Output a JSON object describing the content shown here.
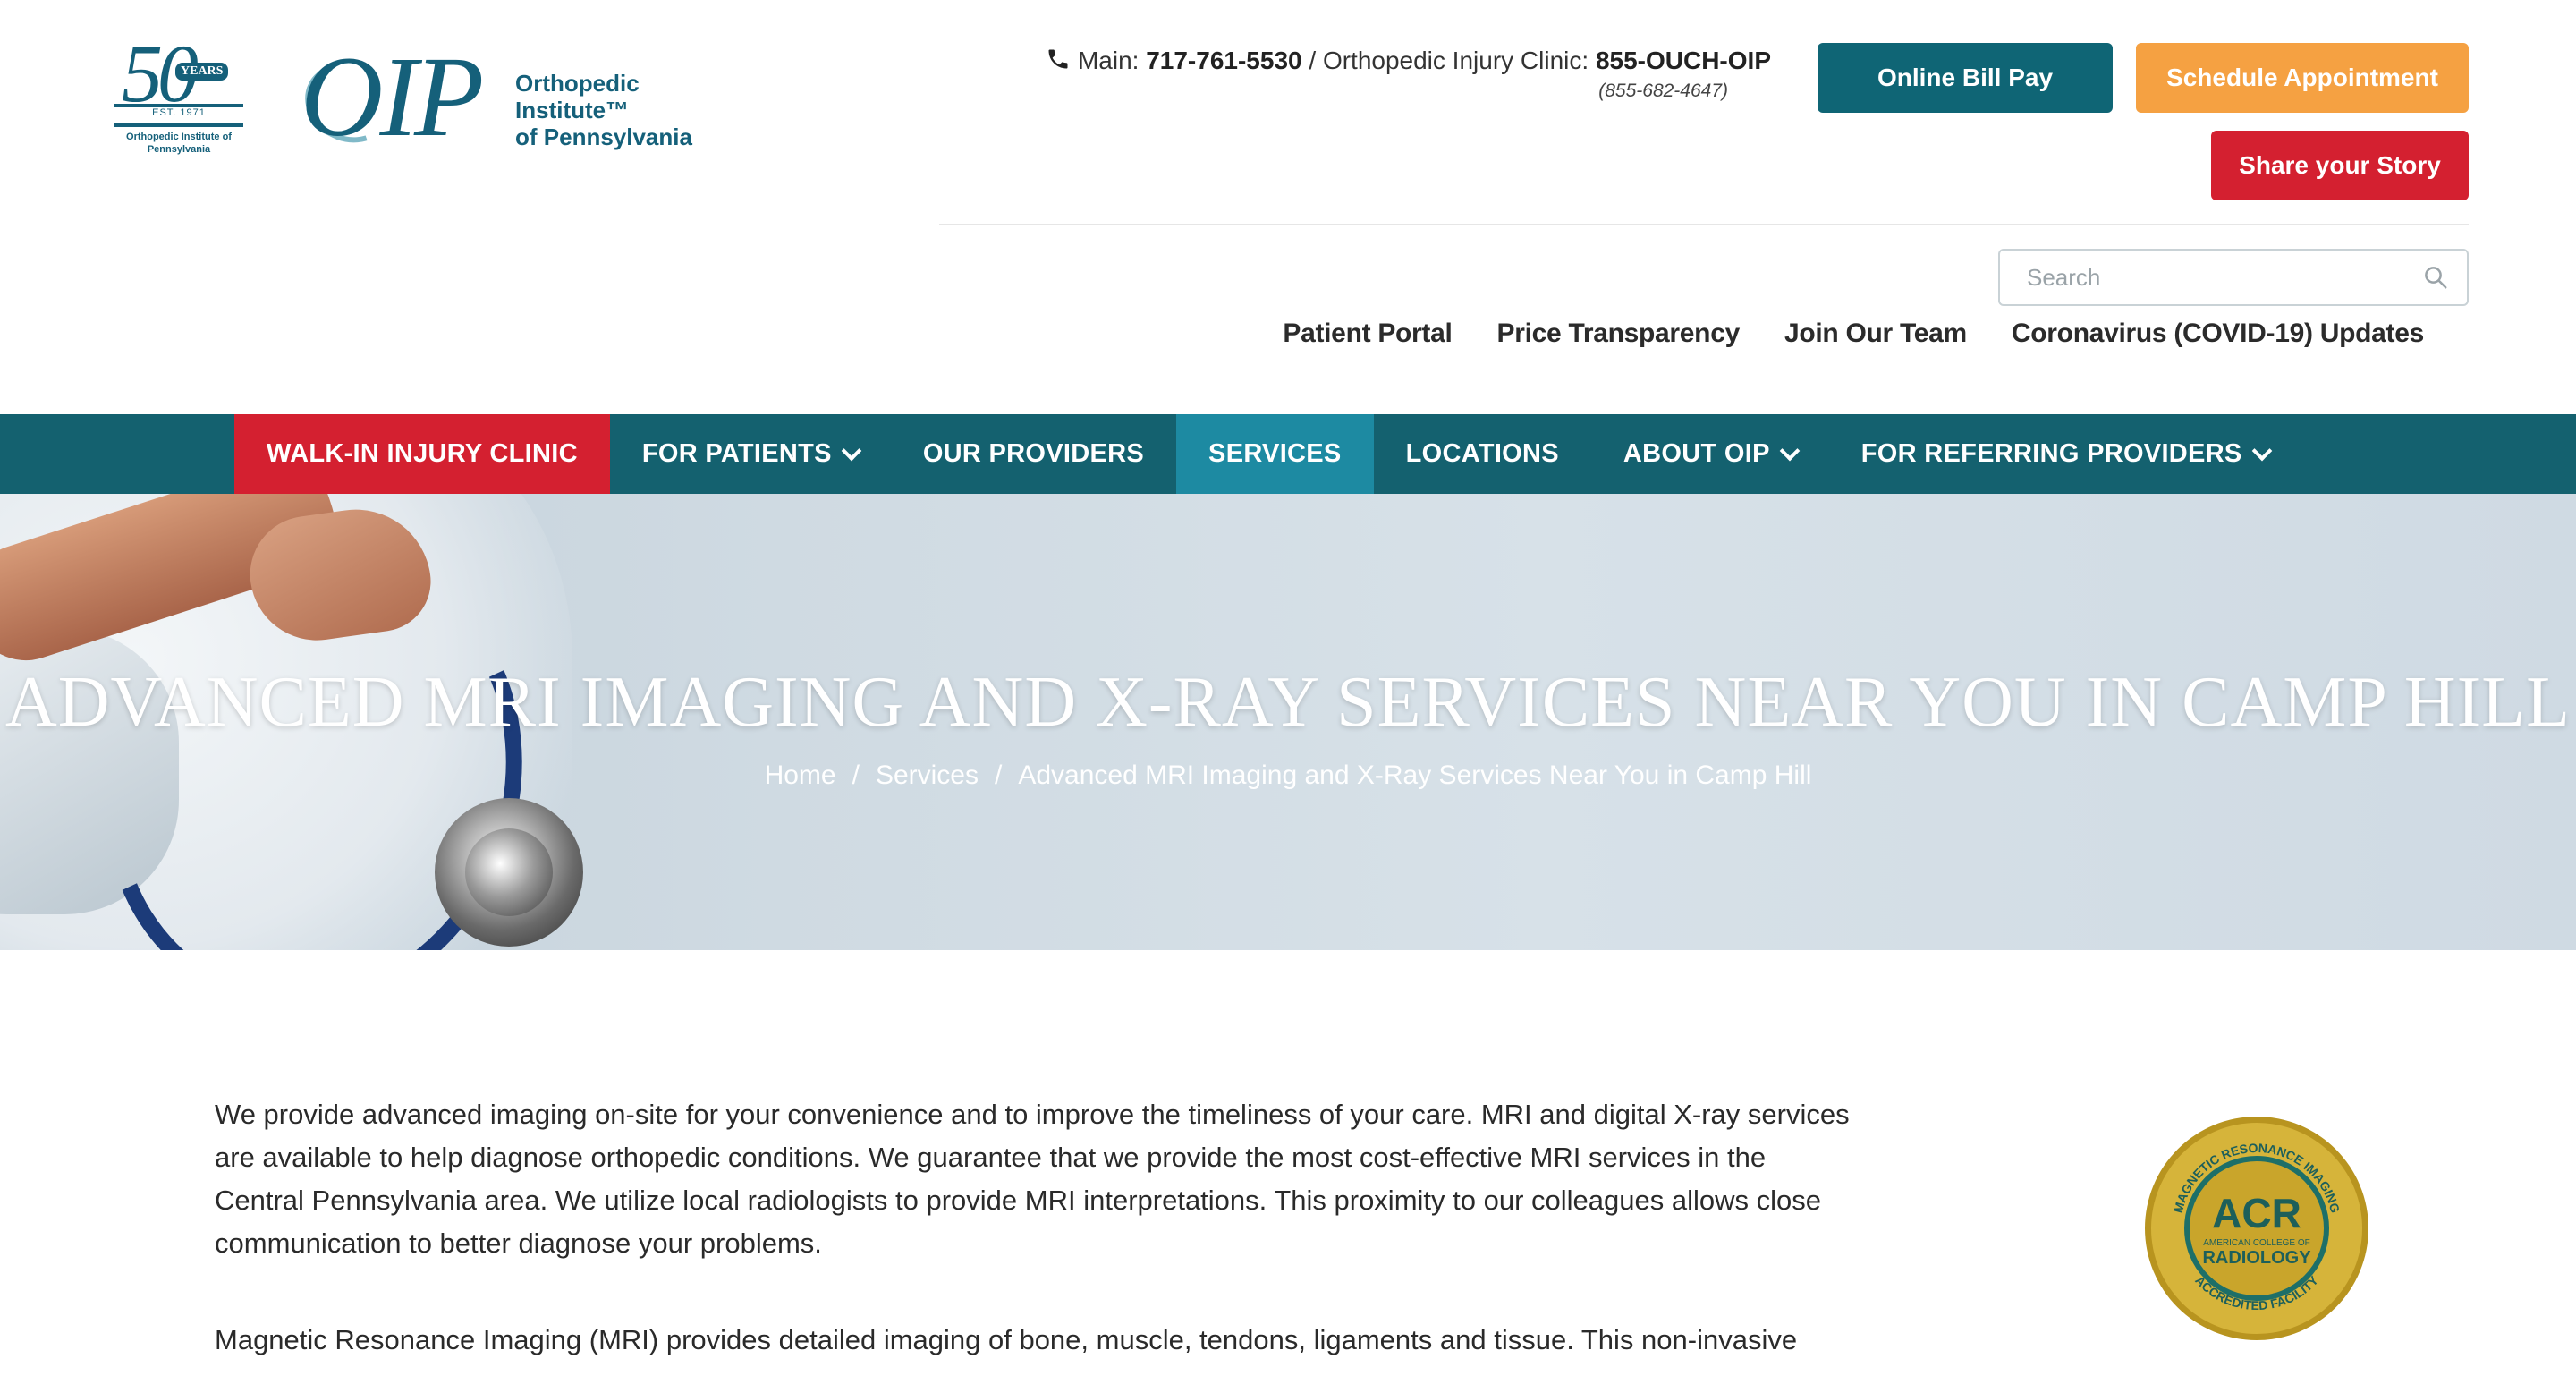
{
  "brand": {
    "anniversary_number": "50",
    "anniversary_years": "YEARS",
    "anniversary_est": "EST. 1971",
    "anniversary_org": "Orthopedic Institute of Pennsylvania",
    "logo_mark": "OIP",
    "logo_name_line1": "Orthopedic Institute™",
    "logo_name_line2": "of Pennsylvania",
    "colors": {
      "primary": "#14616f",
      "accent_orange": "#f5a142",
      "accent_red": "#d42030",
      "active_tab": "#1d8aa2"
    }
  },
  "contact": {
    "icon": "phone-icon",
    "main_label": "Main:",
    "main_number": "717-761-5530",
    "separator": "/",
    "clinic_label": "Orthopedic Injury Clinic:",
    "clinic_number": "855-OUCH-OIP",
    "clinic_numeric": "(855-682-4647)"
  },
  "buttons": {
    "bill_pay": "Online Bill Pay",
    "schedule": "Schedule Appointment",
    "share_story": "Share your Story"
  },
  "search": {
    "placeholder": "Search",
    "icon": "search-icon"
  },
  "utility_links": [
    "Patient Portal",
    "Price Transparency",
    "Join Our Team",
    "Coronavirus (COVID-19) Updates"
  ],
  "nav": {
    "items": [
      {
        "label": "WALK-IN INJURY CLINIC",
        "dropdown": false
      },
      {
        "label": "FOR PATIENTS",
        "dropdown": true
      },
      {
        "label": "OUR PROVIDERS",
        "dropdown": false
      },
      {
        "label": "SERVICES",
        "dropdown": false,
        "active": true
      },
      {
        "label": "LOCATIONS",
        "dropdown": false
      },
      {
        "label": "ABOUT OIP",
        "dropdown": true
      },
      {
        "label": "FOR REFERRING PROVIDERS",
        "dropdown": true
      }
    ]
  },
  "hero": {
    "title": "ADVANCED MRI IMAGING AND X-RAY SERVICES NEAR YOU IN CAMP HILL",
    "breadcrumb": [
      "Home",
      "Services",
      "Advanced MRI Imaging and X-Ray Services Near You in Camp Hill"
    ],
    "breadcrumb_separator": "/"
  },
  "content": {
    "paragraph1": "We provide advanced imaging on-site for your convenience and to improve the timeliness of your care.  MRI and digital X-ray services are available to help diagnose orthopedic conditions.  We guarantee that we provide the most cost-effective MRI services in the Central Pennsylvania area.  We utilize local radiologists to provide MRI interpretations. This proximity to our colleagues allows close communication to better diagnose your problems.",
    "paragraph2": "Magnetic Resonance Imaging (MRI) provides detailed imaging of bone, muscle, tendons, ligaments and tissue. This non-invasive",
    "badge": {
      "top_text": "MAGNETIC RESONANCE IMAGING",
      "center": "ACR",
      "sub": "AMERICAN COLLEGE OF",
      "radiology": "RADIOLOGY",
      "bottom_text": "ACCREDITED FACILITY"
    }
  }
}
